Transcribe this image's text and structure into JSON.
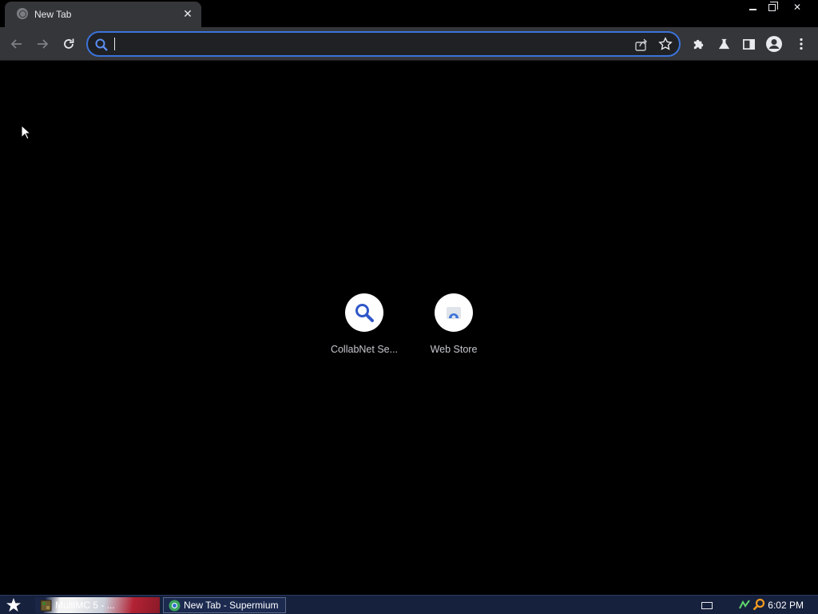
{
  "browser": {
    "tab": {
      "title": "New Tab",
      "close_symbol": "✕"
    },
    "window_controls": {
      "close_symbol": "✕"
    },
    "omnibox": {
      "value": "",
      "placeholder": ""
    }
  },
  "newtab": {
    "shortcuts": [
      {
        "label": "CollabNet Se...",
        "icon": "search-icon"
      },
      {
        "label": "Web Store",
        "icon": "web-store-icon"
      }
    ]
  },
  "taskbar": {
    "items": [
      {
        "label": "MultiMC 5 - ...",
        "icon": "multimc-icon"
      },
      {
        "label": "New Tab - Supermium",
        "icon": "supermium-icon"
      }
    ],
    "clock": "6:02 PM"
  },
  "colors": {
    "accent": "#3b73d9",
    "toolbar": "#35363a",
    "background": "#000000",
    "taskbar": "#16213d"
  }
}
